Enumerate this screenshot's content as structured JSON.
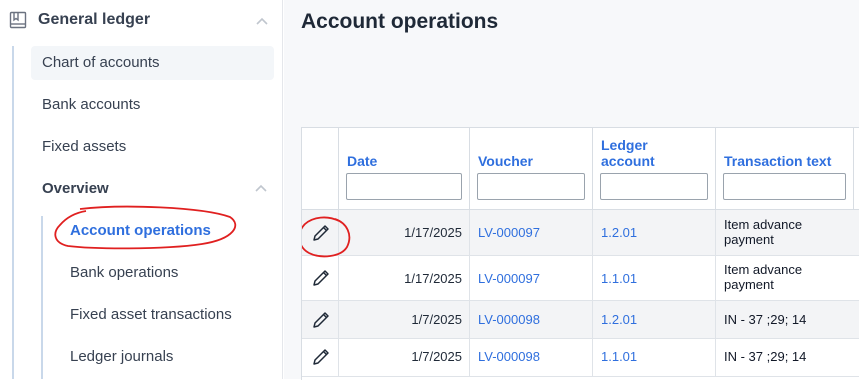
{
  "sidebar": {
    "group_title": "General ledger",
    "items": [
      {
        "label": "Chart of accounts"
      },
      {
        "label": "Bank accounts"
      },
      {
        "label": "Fixed assets"
      }
    ],
    "overview": {
      "label": "Overview",
      "items": [
        {
          "label": "Account operations",
          "active": true
        },
        {
          "label": "Bank operations"
        },
        {
          "label": "Fixed asset transactions"
        },
        {
          "label": "Ledger journals"
        }
      ]
    }
  },
  "page": {
    "title": "Account operations"
  },
  "table": {
    "columns": [
      {
        "key": "edit",
        "label": ""
      },
      {
        "key": "date",
        "label": "Date"
      },
      {
        "key": "voucher",
        "label": "Voucher"
      },
      {
        "key": "ledger_account",
        "label_line1": "Ledger",
        "label_line2": "account"
      },
      {
        "key": "transaction_text",
        "label": "Transaction text"
      }
    ],
    "rows": [
      {
        "date": "1/17/2025",
        "voucher": "LV-000097",
        "ledger_account": "1.2.01",
        "text_line1": "Item advance",
        "text_line2": "payment"
      },
      {
        "date": "1/17/2025",
        "voucher": "LV-000097",
        "ledger_account": "1.1.01",
        "text_line1": "Item advance",
        "text_line2": "payment"
      },
      {
        "date": "1/7/2025",
        "voucher": "LV-000098",
        "ledger_account": "1.2.01",
        "text_line1": "IN - 37 ;29; 14",
        "text_line2": ""
      },
      {
        "date": "1/7/2025",
        "voucher": "LV-000098",
        "ledger_account": "1.1.01",
        "text_line1": "IN - 37 ;29; 14",
        "text_line2": ""
      }
    ]
  },
  "colors": {
    "accent": "#2f6fde",
    "annotation": "#e02020"
  }
}
